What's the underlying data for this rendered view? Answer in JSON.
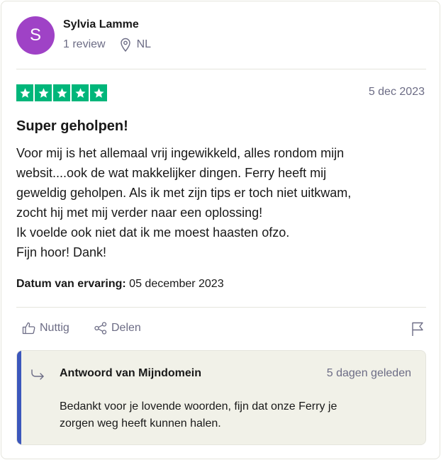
{
  "reviewer": {
    "initial": "S",
    "name": "Sylvia Lamme",
    "review_count": "1 review",
    "country": "NL",
    "avatar_color": "#9f42c6"
  },
  "review": {
    "rating": 5,
    "date": "5 dec 2023",
    "title": "Super geholpen!",
    "lines": [
      "Voor mij is het allemaal vrij ingewikkeld, alles rondom mijn",
      "websit....ook de wat makkelijker dingen. Ferry heeft mij",
      "geweldig geholpen. Als ik met zijn tips er toch niet uitkwam,",
      "zocht hij met mij verder naar een oplossing!",
      "Ik voelde ook niet dat ik me moest haasten ofzo.",
      "Fijn hoor! Dank!"
    ],
    "experience_label": "Datum van ervaring:",
    "experience_date": "05 december 2023",
    "star_color": "#00b67a"
  },
  "actions": {
    "useful_label": "Nuttig",
    "share_label": "Delen"
  },
  "reply": {
    "title": "Antwoord van Mijndomein",
    "time": "5 dagen geleden",
    "lines": [
      "Bedankt voor je lovende woorden, fijn dat onze Ferry je",
      "zorgen weg heeft kunnen halen."
    ],
    "accent_color": "#3c57bc"
  }
}
